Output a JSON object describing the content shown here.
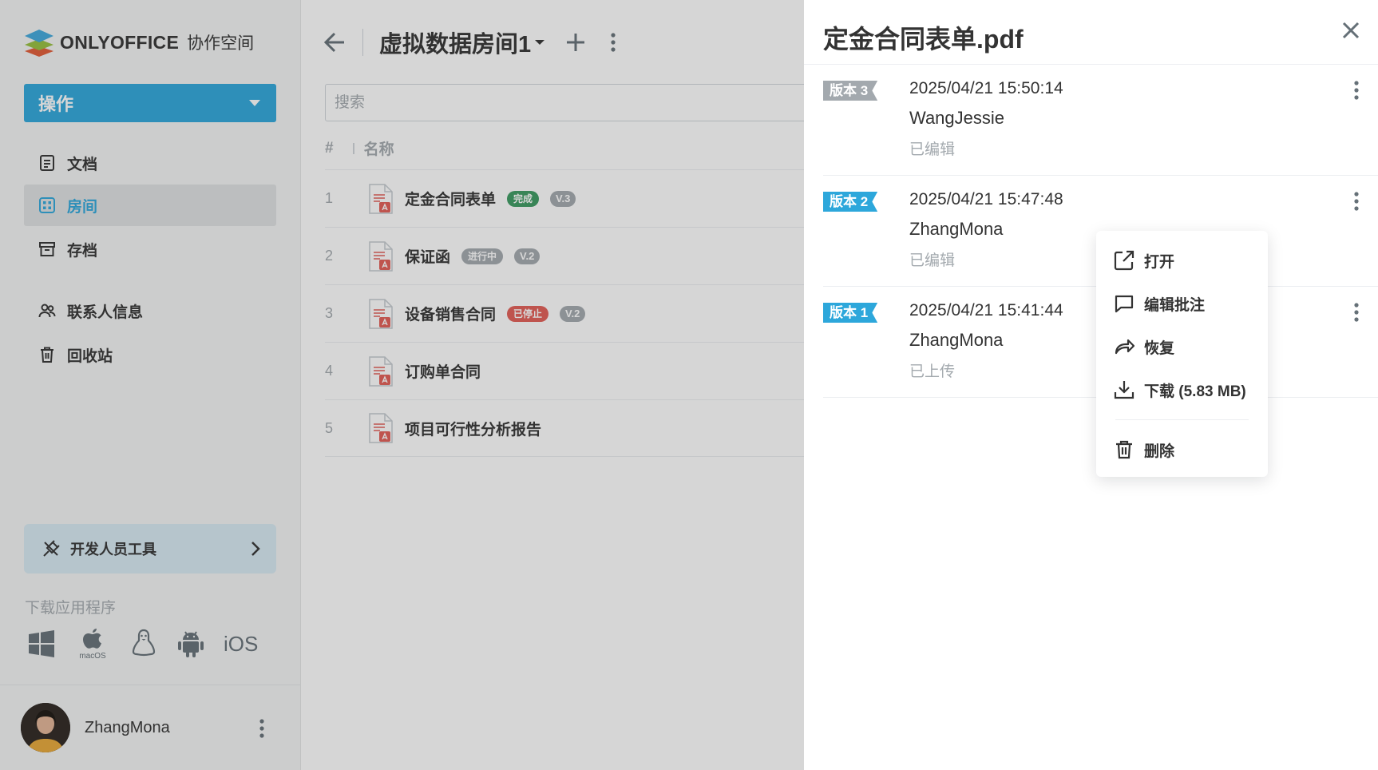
{
  "brand": {
    "name": "ONLYOFFICE",
    "suffix": "协作空间"
  },
  "sidebar": {
    "action_label": "操作",
    "items": [
      {
        "label": "文档",
        "icon": "document-icon",
        "active": false
      },
      {
        "label": "房间",
        "icon": "rooms-icon",
        "active": true
      },
      {
        "label": "存档",
        "icon": "archive-icon",
        "active": false
      },
      {
        "label": "联系人信息",
        "icon": "contacts-icon",
        "active": false
      },
      {
        "label": "回收站",
        "icon": "trash-icon",
        "active": false
      }
    ],
    "dev_tools_label": "开发人员工具",
    "download_label": "下载应用程序",
    "apps": [
      "windows-icon",
      "macos-icon",
      "linux-icon",
      "android-icon",
      "ios-icon"
    ],
    "macos_label": "macOS",
    "ios_label": "iOS",
    "user_name": "ZhangMona"
  },
  "main": {
    "room_title": "虚拟数据房间1",
    "search_placeholder": "搜索",
    "col_num": "#",
    "col_name": "名称",
    "files": [
      {
        "num": "1",
        "name": "定金合同表单",
        "badge": "完成",
        "badge_color": "#3b9a61",
        "version": "V.3"
      },
      {
        "num": "2",
        "name": "保证函",
        "badge": "进行中",
        "badge_color": "#a3a9ae",
        "version": "V.2"
      },
      {
        "num": "3",
        "name": "设备销售合同",
        "badge": "已停止",
        "badge_color": "#e35d55",
        "version": "V.2"
      },
      {
        "num": "4",
        "name": "订购单合同",
        "badge": "",
        "badge_color": "",
        "version": ""
      },
      {
        "num": "5",
        "name": "项目可行性分析报告",
        "badge": "",
        "badge_color": "",
        "version": ""
      }
    ]
  },
  "panel": {
    "title": "定金合同表单.pdf",
    "versions": [
      {
        "tag": "版本 3",
        "date": "2025/04/21 15:50:14",
        "user": "WangJessie",
        "status": "已编辑",
        "tag_color": "#a3a9ae"
      },
      {
        "tag": "版本 2",
        "date": "2025/04/21 15:47:48",
        "user": "ZhangMona",
        "status": "已编辑",
        "tag_color": "#2da7db"
      },
      {
        "tag": "版本 1",
        "date": "2025/04/21 15:41:44",
        "user": "ZhangMona",
        "status": "已上传",
        "tag_color": "#2da7db"
      }
    ]
  },
  "context_menu": {
    "open": "打开",
    "edit_comment": "编辑批注",
    "restore": "恢复",
    "download": "下载 (5.83 MB)",
    "delete": "删除"
  },
  "colors": {
    "accent": "#2da7db",
    "pdf_red": "#e35d55",
    "text": "#333333",
    "muted": "#a3a9ae"
  }
}
